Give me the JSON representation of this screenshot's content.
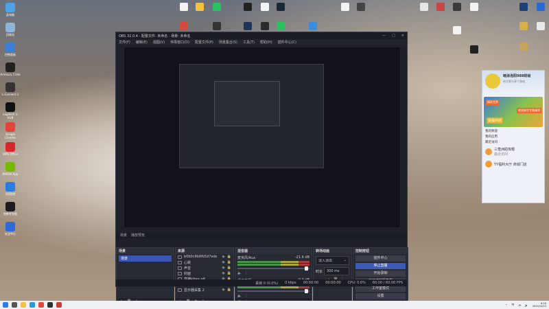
{
  "desktop": {
    "icons_left": [
      {
        "label": "此电脑",
        "icon": "computer-icon",
        "color": "#4aa3e8"
      },
      {
        "label": "回收站",
        "icon": "recycle-bin-icon",
        "color": "#8fb4d9"
      },
      {
        "label": "控制面板",
        "icon": "control-panel-icon",
        "color": "#3d7fd6"
      },
      {
        "label": "Armoury Crate",
        "icon": "armoury-icon",
        "color": "#222222"
      },
      {
        "label": "L-Connect 3",
        "icon": "lconnect-icon",
        "color": "#333333"
      },
      {
        "label": "Logitech G HUB",
        "icon": "logitech-icon",
        "color": "#111111"
      },
      {
        "label": "Google Chrome",
        "icon": "chrome-icon",
        "color": "#e0473a"
      },
      {
        "label": "WPS Office",
        "icon": "wps-icon",
        "color": "#d5282a"
      },
      {
        "label": "NVIDIA App",
        "icon": "nvidia-icon",
        "color": "#76b900"
      },
      {
        "label": "QQ游戏",
        "icon": "qq-game-icon",
        "color": "#2a7de1"
      },
      {
        "label": "剪映专业版",
        "icon": "capcut-icon",
        "color": "#1d1d1d"
      },
      {
        "label": "安全中心",
        "icon": "shield-icon",
        "color": "#2f6ad8"
      }
    ]
  },
  "obs": {
    "title": "OBS 32.0.4 - 配置文件: 未命名 - 场景: 未命名",
    "menu": [
      "文件(F)",
      "编辑(E)",
      "视图(V)",
      "停靠窗口(D)",
      "配置文件(P)",
      "场景集合(S)",
      "工具(T)",
      "帮助(H)",
      "插件中心(C)"
    ],
    "scene_bar": [
      "场景",
      "播放预览"
    ],
    "scenes": {
      "title": "场景",
      "items": [
        "场景"
      ]
    },
    "sources": {
      "title": "来源",
      "items": [
        "b0b0c9b6fb5d7edebaff6b1cdee",
        "心跳",
        "声音",
        "封面",
        "直播ktbm.gif",
        "显示器采集",
        "显示器采集 2"
      ]
    },
    "mixer": {
      "title": "混音器",
      "tracks": [
        {
          "name": "麦克风/Aux",
          "db": "-21.6 dB"
        },
        {
          "name": "桌面音频",
          "db": "-0.0 dB"
        }
      ]
    },
    "transitions": {
      "title": "转场动画",
      "type": "淡入淡出",
      "duration_label": "时长",
      "duration": "300 ms"
    },
    "controls": {
      "title": "控制按钮",
      "buttons": [
        "插件中心",
        "停止直播",
        "开始录制",
        "启动虚拟摄像机",
        "工作室模式",
        "设置",
        "退出"
      ]
    },
    "status": {
      "dropped": "丢帧 0 (0.0%)",
      "bitrate": "0 kbps",
      "stream_time": "00:00:00",
      "rec_time": "00:00:00",
      "cpu": "CPU: 0.6%",
      "fps": "60.00 / 60.00 FPS"
    }
  },
  "qq": {
    "name": "暗涂洛阳988财级",
    "status": "给大家分享个游戏",
    "banner_text": "精彩世界",
    "banner_tag": "感觉新世专属福利",
    "banner_title": "遊戲商城",
    "menu": [
      "我的频道",
      "我的应用",
      "最近访问"
    ],
    "items": [
      {
        "title": "三角洲助攻眼",
        "sub": "最近访问"
      },
      {
        "title": "YY福利大厅 商城门店",
        "sub": ""
      }
    ]
  },
  "taskbar": {
    "apps": [
      {
        "icon": "windows-start-icon",
        "color": "#2b7de9"
      },
      {
        "icon": "search-icon",
        "color": "#555555"
      },
      {
        "icon": "file-explorer-icon",
        "color": "#f2c23c"
      },
      {
        "icon": "edge-icon",
        "color": "#2a9bd8"
      },
      {
        "icon": "chrome-icon",
        "color": "#e0473a"
      },
      {
        "icon": "obs-icon",
        "color": "#303030"
      },
      {
        "icon": "game-icon",
        "color": "#c73d32"
      }
    ],
    "ime": "中",
    "time": "8:16",
    "date": "2025/10/23"
  }
}
